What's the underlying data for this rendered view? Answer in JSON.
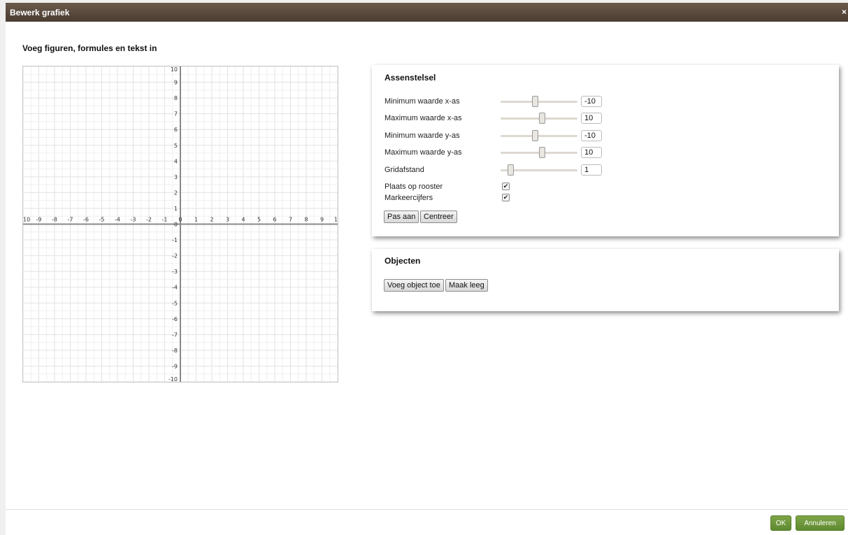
{
  "dialog": {
    "title": "Bewerk grafiek",
    "close_glyph": "×",
    "heading": "Voeg figuren, formules en tekst in"
  },
  "graph": {
    "xlim": [
      -10,
      10
    ],
    "ylim": [
      -10,
      10
    ],
    "grid_step": 1,
    "x_labels": [
      "10",
      "-9",
      "-8",
      "-7",
      "-6",
      "-5",
      "-4",
      "-3",
      "-2",
      "-1",
      "0",
      "1",
      "2",
      "3",
      "4",
      "5",
      "6",
      "7",
      "8",
      "9",
      "1"
    ],
    "y_labels": [
      "10",
      "9",
      "8",
      "7",
      "6",
      "5",
      "4",
      "3",
      "2",
      "1",
      "0",
      "-1",
      "-2",
      "-3",
      "-4",
      "-5",
      "-6",
      "-7",
      "-8",
      "-9",
      "-10"
    ]
  },
  "axes_panel": {
    "title": "Assenstelsel",
    "sliders": [
      {
        "label": "Minimum waarde x-as",
        "value": "-10",
        "position": 0.45
      },
      {
        "label": "Maximum waarde x-as",
        "value": "10",
        "position": 0.55
      },
      {
        "label": "Minimum waarde y-as",
        "value": "-10",
        "position": 0.45
      },
      {
        "label": "Maximum waarde y-as",
        "value": "10",
        "position": 0.55
      },
      {
        "label": "Gridafstand",
        "value": "1",
        "position": 0.13
      }
    ],
    "checkboxes": [
      {
        "label": "Plaats op rooster",
        "checked": true
      },
      {
        "label": "Markeercijfers",
        "checked": true
      }
    ],
    "check_glyph": "✔",
    "buttons": [
      "Pas aan",
      "Centreer"
    ]
  },
  "objects_panel": {
    "title": "Objecten",
    "buttons": [
      "Voeg object toe",
      "Maak leeg"
    ]
  },
  "footer": {
    "ok_label": "OK",
    "cancel_label": "Annuleren"
  }
}
